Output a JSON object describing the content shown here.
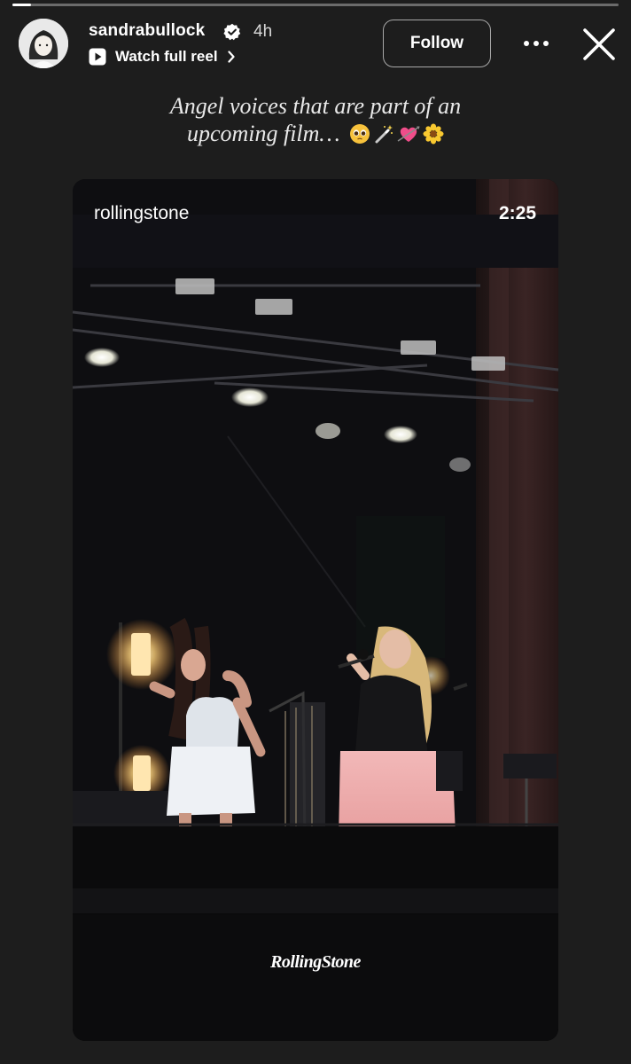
{
  "story": {
    "progress": 0.03
  },
  "header": {
    "username": "sandrabullock",
    "verified": true,
    "time_ago": "4h",
    "reel_link_label": "Watch full reel",
    "follow_label": "Follow"
  },
  "caption": {
    "line1": "Angel voices that are part of an",
    "line2": "upcoming film…",
    "emojis": [
      "pleading-face-emoji",
      "magic-wand-emoji",
      "heart-with-arrow-emoji",
      "blossom-emoji"
    ]
  },
  "video": {
    "source_label": "rollingstone",
    "duration": "2:25",
    "watermark": "RollingStone"
  },
  "icons": {
    "verified": "verified-badge-icon",
    "play": "play-icon",
    "chevron": "chevron-right-icon",
    "more": "more-options-icon",
    "close": "close-icon"
  },
  "colors": {
    "background": "#1d1d1d",
    "verified_badge": "#ffffff",
    "follow_border": "#a8a8a8"
  }
}
